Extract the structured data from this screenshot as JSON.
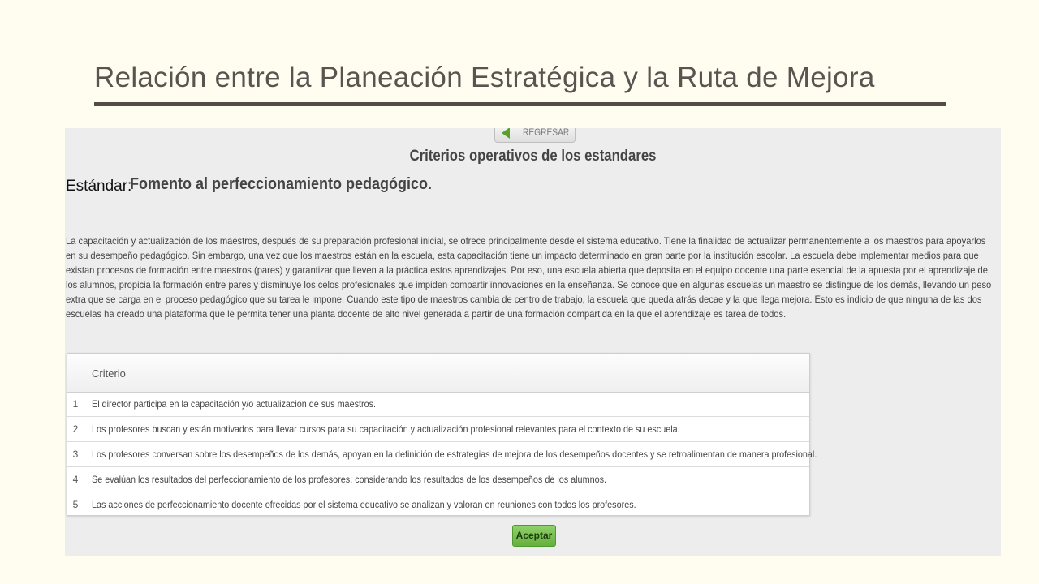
{
  "slide": {
    "title": "Relación entre la Planeación Estratégica y la Ruta de Mejora"
  },
  "screenshot": {
    "back_button_label": "REGRESAR",
    "section_title": "Criterios operativos de los estandares",
    "estandar_label": "Estándar:",
    "estandar_value": "Fomento al perfeccionamiento pedagógico.",
    "description": "La capacitación y actualización de los maestros, después de su preparación profesional inicial, se ofrece principalmente desde el sistema educativo. Tiene la finalidad de actualizar permanentemente a los maestros para apoyarlos en su desempeño pedagógico. Sin embargo, una vez que los maestros están en la escuela, esta capacitación tiene un impacto determinado en gran parte por la institución escolar. La escuela debe implementar medios para que existan procesos de formación entre maestros (pares) y garantizar que lleven a la práctica estos aprendizajes. Por eso, una escuela abierta que deposita en el equipo docente una parte esencial de la apuesta por el aprendizaje de los alumnos, propicia la formación entre pares y disminuye los celos profesionales que impiden compartir innovaciones en la enseñanza. Se conoce que en algunas escuelas un maestro se distingue de los demás, llevando un peso extra que se carga en el proceso pedagógico que su tarea le impone. Cuando este tipo de maestros cambia de centro de trabajo, la escuela que queda atrás decae y la que llega mejora. Esto es indicio de que ninguna de las dos escuelas ha creado una plataforma que le permita tener una planta docente de alto nivel generada a partir de una formación compartida en la que el aprendizaje es tarea de todos.",
    "table": {
      "header": "Criterio",
      "rows": [
        {
          "num": "1",
          "text": "El director participa en la capacitación y/o actualización de sus maestros."
        },
        {
          "num": "2",
          "text": "Los profesores buscan y están motivados para llevar cursos para su capacitación y actualización profesional relevantes para el contexto de su escuela."
        },
        {
          "num": "3",
          "text": "Los profesores conversan sobre los desempeños de los demás, apoyan en la definición de estrategias de mejora de los desempeños docentes y se retroalimentan de manera profesional."
        },
        {
          "num": "4",
          "text": "Se evalúan los resultados del perfeccionamiento de los profesores, considerando los resultados de los desempeños de los alumnos."
        },
        {
          "num": "5",
          "text": "Las acciones de perfeccionamiento docente ofrecidas por el sistema educativo se analizan y valoran en reuniones con todos los profesores."
        }
      ]
    },
    "accept_button_label": "Aceptar"
  },
  "colors": {
    "slide_background": "#fefdf0",
    "title_text": "#5a5450",
    "rule": "#524b47",
    "accept_button": "#6fbb45"
  },
  "icons": {
    "back_button_icon": "back-arrow-icon"
  }
}
